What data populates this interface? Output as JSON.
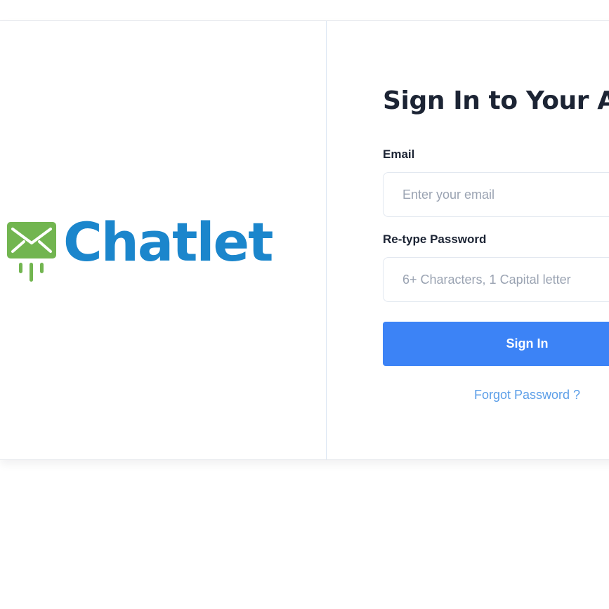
{
  "brand": {
    "name": "Chatlet",
    "text_color": "#1b86cc",
    "icon": "envelope-icon",
    "icon_color": "#72b550"
  },
  "signin": {
    "title": "Sign In to Your Account",
    "email": {
      "label": "Email",
      "placeholder": "Enter your email",
      "value": ""
    },
    "password": {
      "label": "Re-type Password",
      "placeholder": "6+ Characters, 1 Capital letter",
      "value": ""
    },
    "submit_label": "Sign In",
    "forgot_label": "Forgot Password ?"
  },
  "colors": {
    "primary": "#3c83f6",
    "link": "#5b9ee8",
    "heading": "#1c2434",
    "placeholder": "#9aa3b2",
    "border": "#e2e8f0"
  }
}
